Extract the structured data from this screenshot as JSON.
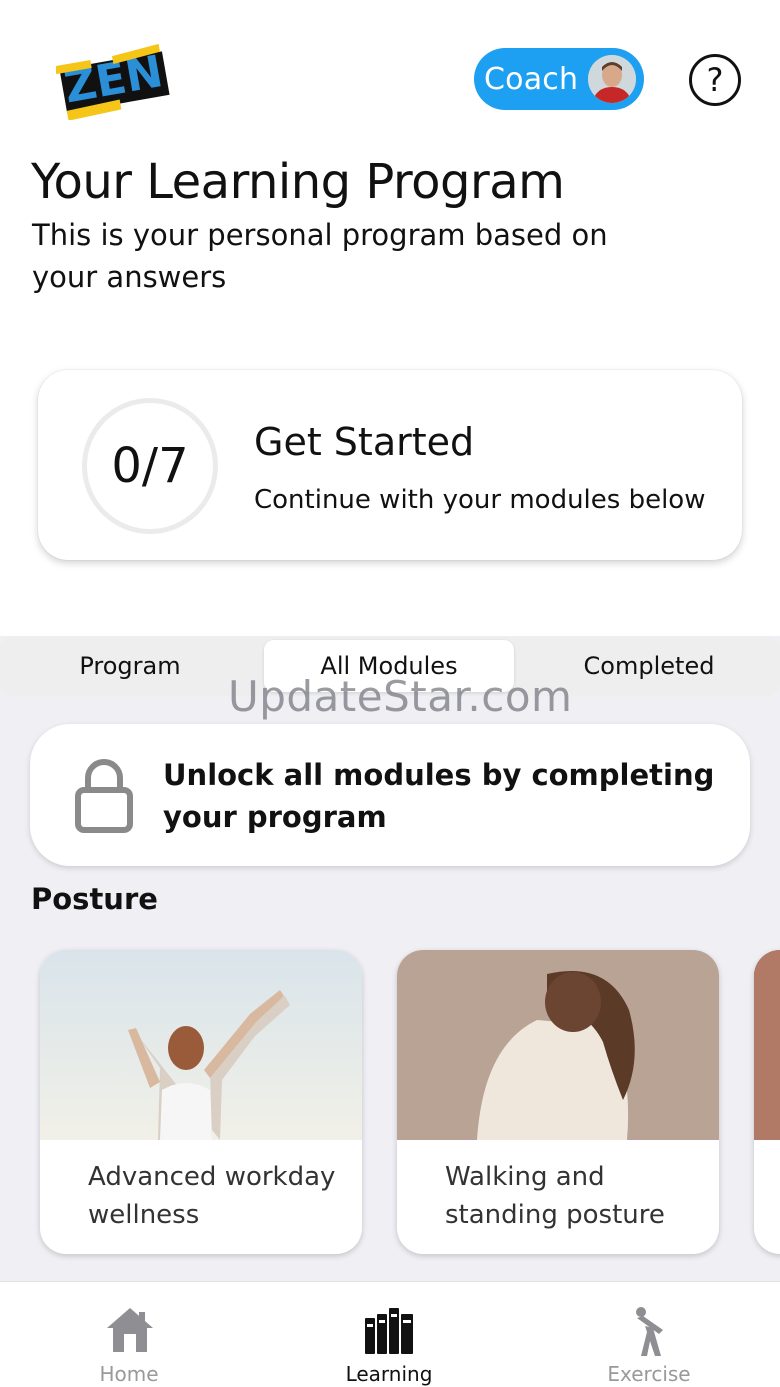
{
  "header": {
    "logo_text": "ZEN",
    "coach_label": "Coach",
    "help_glyph": "?"
  },
  "intro": {
    "title": "Your Learning Program",
    "subtitle": "This is your personal program based on your answers"
  },
  "progress_card": {
    "count": "0/7",
    "completed": 0,
    "total": 7,
    "title": "Get Started",
    "subtitle": "Continue with your modules below"
  },
  "segments": {
    "items": [
      "Program",
      "All Modules",
      "Completed"
    ],
    "selected": "All Modules"
  },
  "watermark": "UpdateStar.com",
  "unlock": {
    "icon": "lock-icon",
    "text": "Unlock all modules by completing your program"
  },
  "posture": {
    "title": "Posture",
    "modules": [
      {
        "label": "Advanced workday wellness"
      },
      {
        "label": "Walking and standing posture"
      }
    ]
  },
  "tabbar": {
    "tabs": [
      {
        "label": "Home",
        "icon": "home-icon"
      },
      {
        "label": "Learning",
        "icon": "books-icon"
      },
      {
        "label": "Exercise",
        "icon": "exercise-icon"
      }
    ],
    "active": "Learning"
  },
  "colors": {
    "accent": "#1ea0f2",
    "background_gray": "#efeff4",
    "logo_yellow": "#f5c518",
    "logo_blue": "#2b8fd8"
  }
}
